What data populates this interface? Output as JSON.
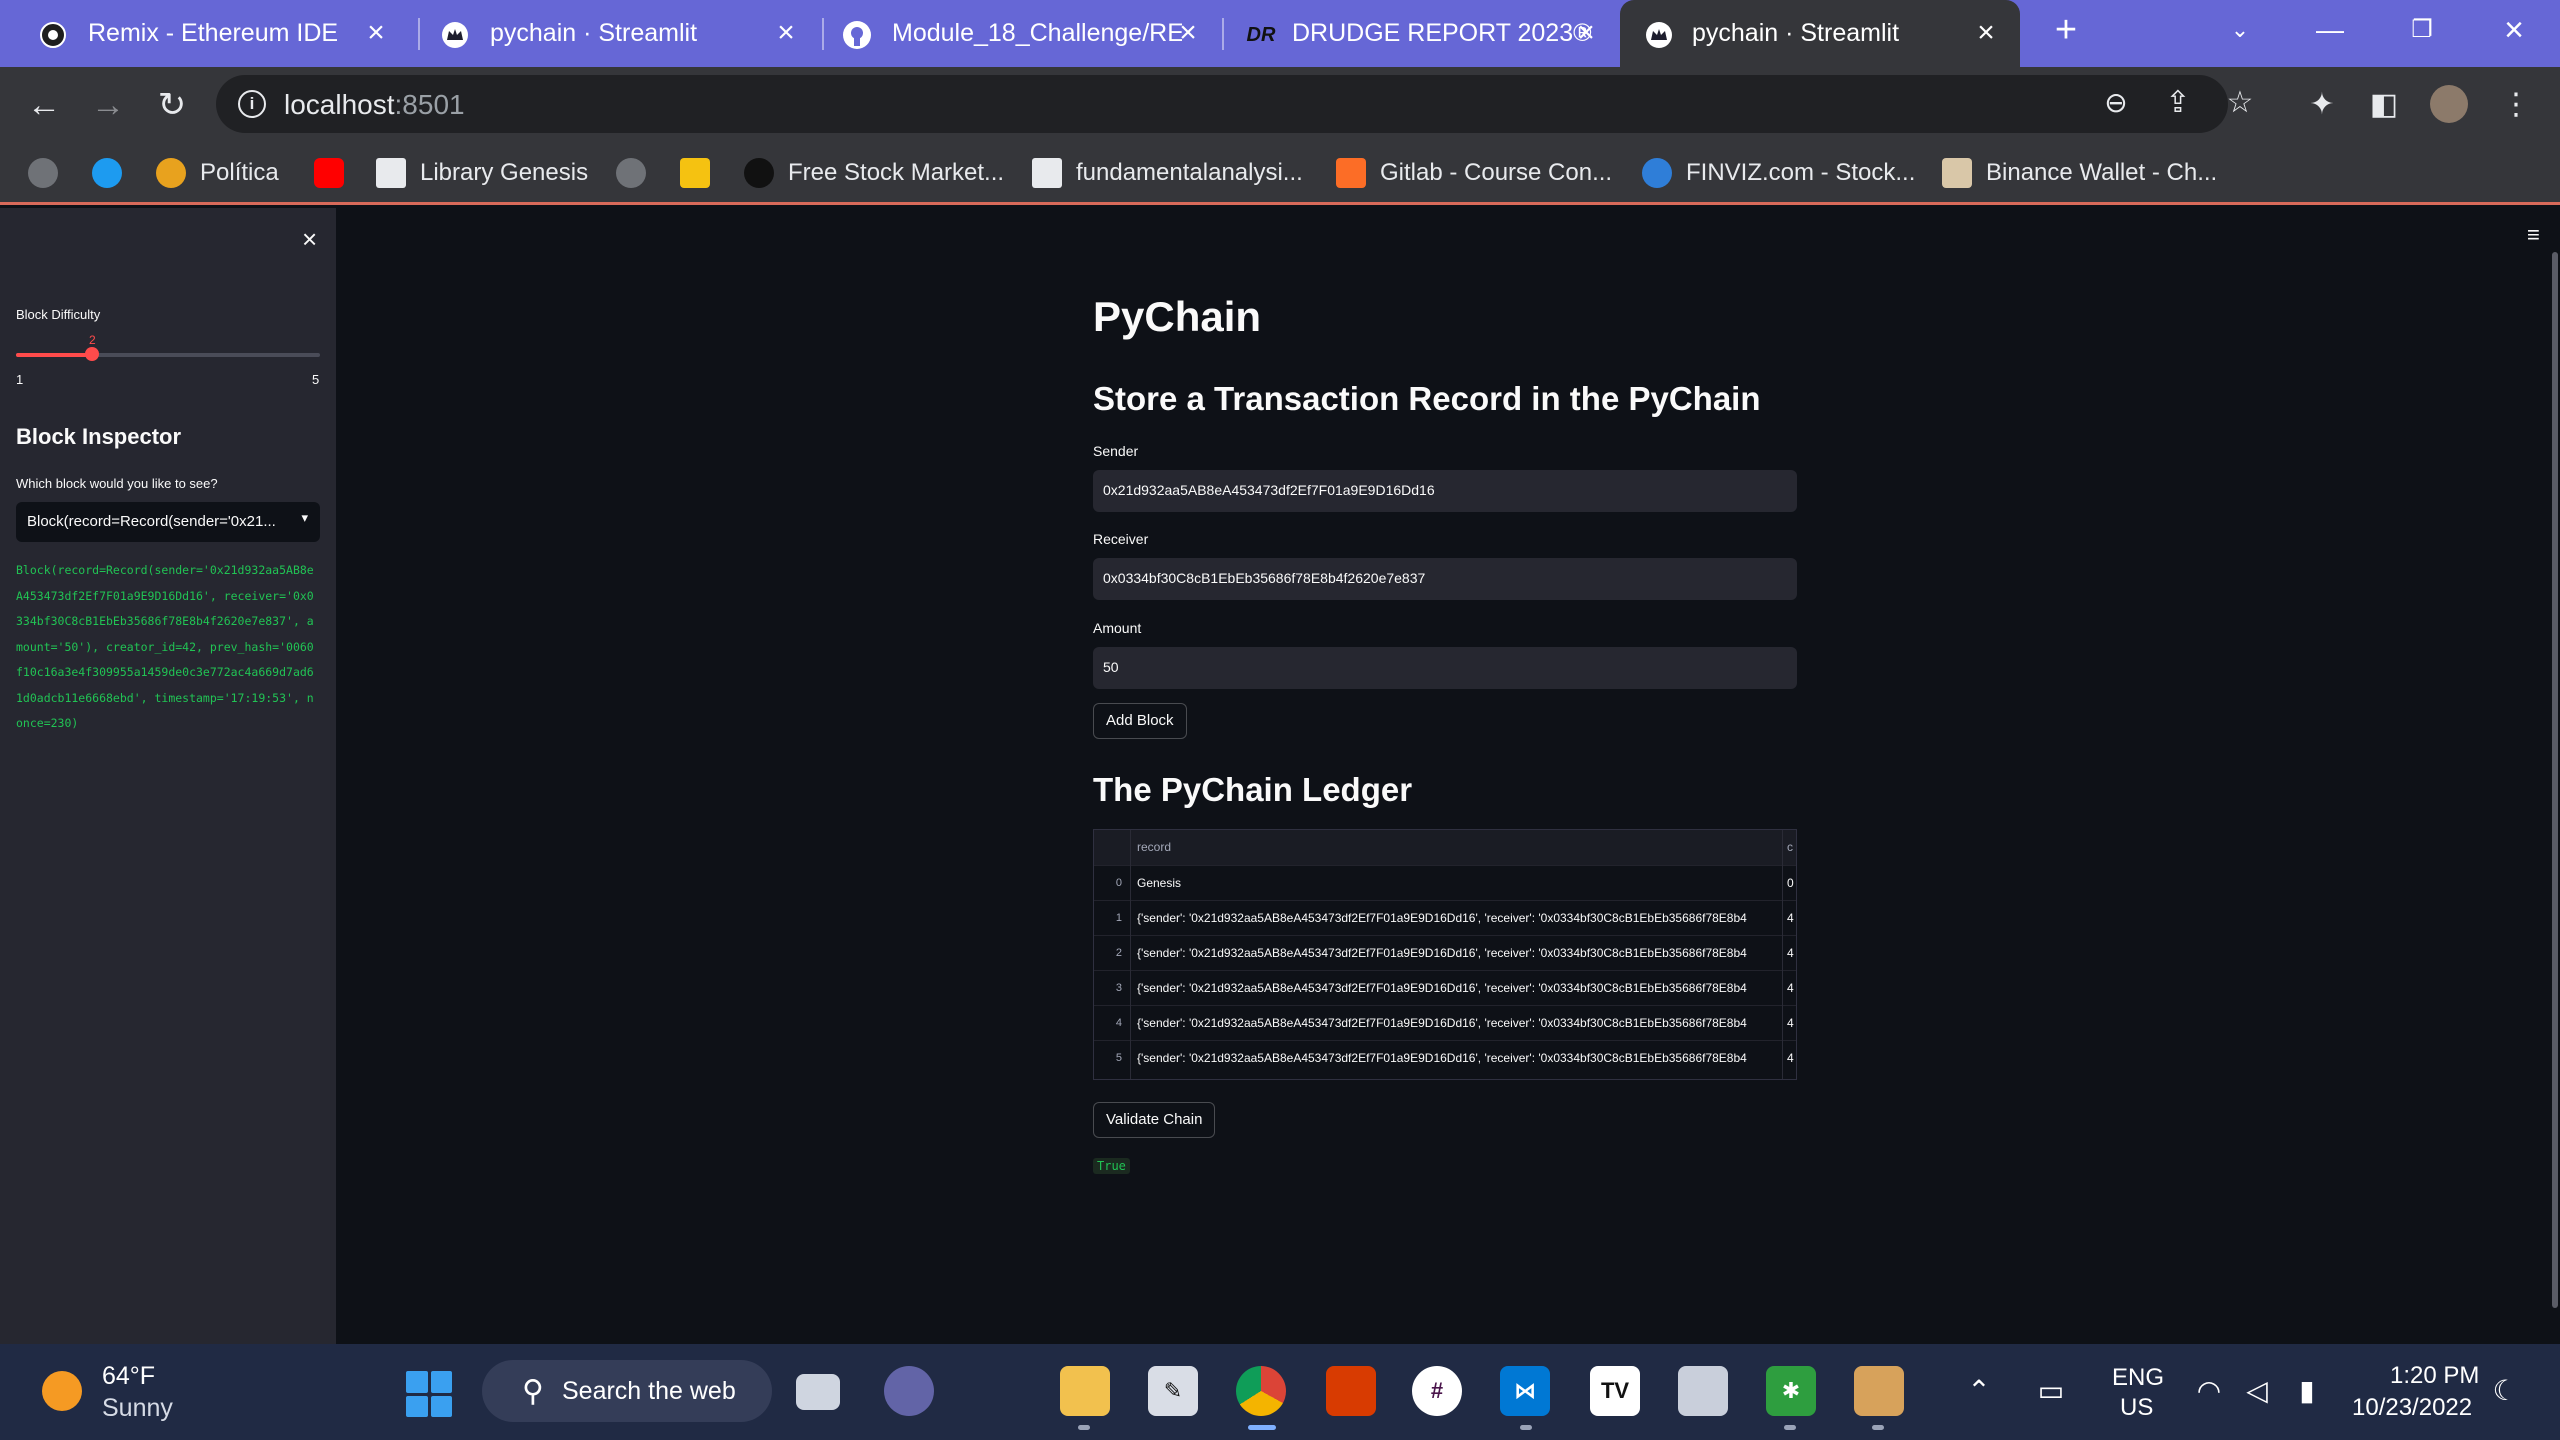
{
  "browser": {
    "tabs": [
      {
        "title": "Remix - Ethereum IDE",
        "icon": "remix-icon"
      },
      {
        "title": "pychain · Streamlit",
        "icon": "streamlit-crown-icon"
      },
      {
        "title": "Module_18_Challenge/RE",
        "icon": "github-icon"
      },
      {
        "title": "DRUDGE REPORT 2023®",
        "icon": "drudge-icon"
      },
      {
        "title": "pychain · Streamlit",
        "icon": "streamlit-crown-icon",
        "active": true
      }
    ],
    "new_tab": "+",
    "url_host": "localhost",
    "url_port": ":8501",
    "bookmarks": [
      {
        "label": "",
        "icon": "globe-icon"
      },
      {
        "label": "",
        "icon": "twitter-icon"
      },
      {
        "label": "Política",
        "icon": "politica-icon"
      },
      {
        "label": "",
        "icon": "youtube-icon"
      },
      {
        "label": "Library Genesis",
        "icon": "libgen-icon"
      },
      {
        "label": "",
        "icon": "globe-icon"
      },
      {
        "label": "",
        "icon": "keep-icon"
      },
      {
        "label": "Free Stock Market...",
        "icon": "stock-icon"
      },
      {
        "label": "fundamentalanalysi...",
        "icon": "page-icon"
      },
      {
        "label": "Gitlab - Course Con...",
        "icon": "gitlab-icon"
      },
      {
        "label": "FINVIZ.com - Stock...",
        "icon": "finviz-icon"
      },
      {
        "label": "Binance Wallet - Ch...",
        "icon": "binance-icon"
      }
    ]
  },
  "sidebar": {
    "difficulty_label": "Block Difficulty",
    "difficulty_value": "2",
    "difficulty_min": "1",
    "difficulty_max": "5",
    "difficulty_fraction": 0.25,
    "inspector_heading": "Block Inspector",
    "select_label": "Which block would you like to see?",
    "select_value": "Block(record=Record(sender='0x21...",
    "block_code": "Block(record=Record(sender='0x21d932aa5AB8eA453473df2Ef7F01a9E9D16Dd16', receiver='0x0334bf30C8cB1EbEb35686f78E8b4f2620e7e837', amount='50'), creator_id=42, prev_hash='0060f10c16a3e4f309955a1459de0c3e772ac4a669d7ad61d0adcb11e6668ebd', timestamp='17:19:53', nonce=230)"
  },
  "main": {
    "title": "PyChain",
    "subtitle": "Store a Transaction Record in the PyChain",
    "sender_label": "Sender",
    "sender_value": "0x21d932aa5AB8eA453473df2Ef7F01a9E9D16Dd16",
    "receiver_label": "Receiver",
    "receiver_value": "0x0334bf30C8cB1EbEb35686f78E8b4f2620e7e837",
    "amount_label": "Amount",
    "amount_value": "50",
    "add_block_label": "Add Block",
    "ledger_title": "The PyChain Ledger",
    "ledger_columns": [
      "record",
      "c"
    ],
    "ledger_rows": [
      {
        "idx": "0",
        "record": "Genesis",
        "c2": "0"
      },
      {
        "idx": "1",
        "record": "{'sender': '0x21d932aa5AB8eA453473df2Ef7F01a9E9D16Dd16', 'receiver': '0x0334bf30C8cB1EbEb35686f78E8b4",
        "c2": "4"
      },
      {
        "idx": "2",
        "record": "{'sender': '0x21d932aa5AB8eA453473df2Ef7F01a9E9D16Dd16', 'receiver': '0x0334bf30C8cB1EbEb35686f78E8b4",
        "c2": "4"
      },
      {
        "idx": "3",
        "record": "{'sender': '0x21d932aa5AB8eA453473df2Ef7F01a9E9D16Dd16', 'receiver': '0x0334bf30C8cB1EbEb35686f78E8b4",
        "c2": "4"
      },
      {
        "idx": "4",
        "record": "{'sender': '0x21d932aa5AB8eA453473df2Ef7F01a9E9D16Dd16', 'receiver': '0x0334bf30C8cB1EbEb35686f78E8b4",
        "c2": "4"
      },
      {
        "idx": "5",
        "record": "{'sender': '0x21d932aa5AB8eA453473df2Ef7F01a9E9D16Dd16', 'receiver': '0x0334bf30C8cB1EbEb35686f78E8b4",
        "c2": "4"
      }
    ],
    "validate_label": "Validate Chain",
    "validate_result": "True"
  },
  "taskbar": {
    "weather_temp": "64°F",
    "weather_cond": "Sunny",
    "search_text": "Search the web",
    "lang1": "ENG",
    "lang2": "US",
    "time": "1:20 PM",
    "date": "10/23/2022",
    "apps": [
      "file-explorer-icon",
      "inkscape-icon",
      "chrome-icon",
      "office-icon",
      "slack-icon",
      "vscode-icon",
      "tradingview-icon",
      "app-icon",
      "green-app-icon",
      "package-icon"
    ]
  },
  "colors": {
    "accent": "#ff4b4b",
    "code_green": "#21c354",
    "tabbar": "#6667d6",
    "page_bg": "#0e1117",
    "sidebar_bg": "#262730"
  }
}
